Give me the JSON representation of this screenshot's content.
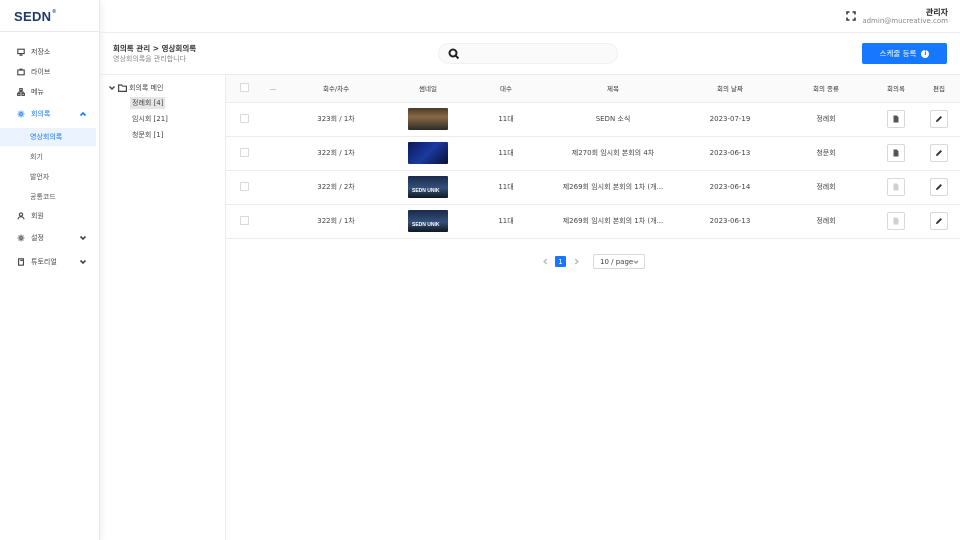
{
  "app": {
    "logo": "SEDN",
    "logo_mark": "®"
  },
  "sidebar": {
    "items": [
      {
        "label": "저장소",
        "icon": "monitor-icon"
      },
      {
        "label": "라이브",
        "icon": "tv-icon"
      },
      {
        "label": "메뉴",
        "icon": "sitemap-icon"
      },
      {
        "label": "회의록",
        "icon": "gear-icon",
        "expanded": true
      },
      {
        "label": "회원",
        "icon": "user-icon"
      },
      {
        "label": "설정",
        "icon": "gear-icon"
      },
      {
        "label": "튜토리얼",
        "icon": "book-icon"
      }
    ],
    "subitems": [
      {
        "label": "영상회의록",
        "selected": true
      },
      {
        "label": "회기"
      },
      {
        "label": "발언자"
      },
      {
        "label": "공통코드"
      }
    ]
  },
  "topbar": {
    "user_name": "관리자",
    "user_email": "admin@mucreative.com"
  },
  "header": {
    "breadcrumb": "회의록 관리 > 영상회의록",
    "subtitle": "영상회의록을 관리합니다",
    "search_placeholder": "",
    "register_label": "스케줄 등록",
    "register_info": "i"
  },
  "tree": {
    "root": "회의록 메인",
    "nodes": [
      {
        "label": "정례회 [4]",
        "selected": true
      },
      {
        "label": "임시회 [21]"
      },
      {
        "label": "청문회 [1]"
      }
    ]
  },
  "table": {
    "columns": [
      "",
      "...",
      "회수/차수",
      "썸네일",
      "대수",
      "제목",
      "회의 날짜",
      "회의 종류",
      "회의록",
      "편집"
    ],
    "rows": [
      {
        "session": "323회 / 1차",
        "thumb_text": "",
        "term": "11대",
        "title": "SEDN 소식",
        "date": "2023-07-19",
        "type": "정례회",
        "minutes_enabled": true
      },
      {
        "session": "322회 / 1차",
        "thumb_text": "",
        "term": "11대",
        "title": "제270회 임시회 본회의 4차",
        "date": "2023-06-13",
        "type": "청문회",
        "minutes_enabled": true
      },
      {
        "session": "322회 / 2차",
        "thumb_text": "SEDN UNIK",
        "term": "11대",
        "title": "제269회 임시회 본회의 1차 (개...",
        "date": "2023-06-14",
        "type": "정례회",
        "minutes_enabled": false
      },
      {
        "session": "322회 / 1차",
        "thumb_text": "SEDN UNIK",
        "term": "11대",
        "title": "제269회 임시회 본회의 1차 (개...",
        "date": "2023-06-13",
        "type": "정례회",
        "minutes_enabled": false
      }
    ]
  },
  "pagination": {
    "current": "1",
    "page_size": "10 / page"
  },
  "colors": {
    "primary": "#1677ff",
    "logo": "#1f3a6b"
  }
}
